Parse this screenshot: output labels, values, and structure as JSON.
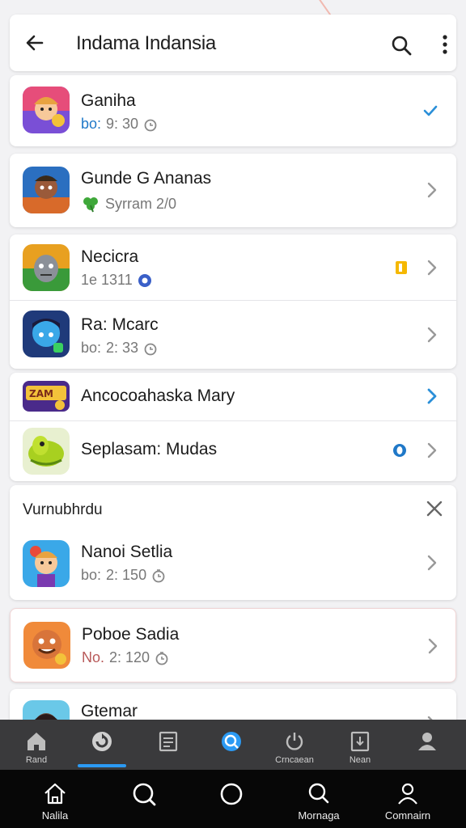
{
  "header": {
    "title": "Indama Indansia"
  },
  "apps": [
    {
      "name": "Ganiha",
      "meta_prefix": "bo:",
      "meta_value": "9: 30",
      "action": "check"
    },
    {
      "name": "Gunde G Ananas",
      "meta_prefix": "",
      "meta_value": "Syrram  2/0",
      "action": "chevron"
    },
    {
      "name": "Necicra",
      "meta_prefix": "",
      "meta_value": "1e 1311",
      "action": "chevron"
    },
    {
      "name": "Ra: Mcarc",
      "meta_prefix": "bo:",
      "meta_value": "2: 33",
      "action": "chevron"
    },
    {
      "name": "Ancocoahaska Mary",
      "action": "chevron-blue"
    },
    {
      "name": "Seplasam: Mudas",
      "action": "chevron"
    },
    {
      "name": "Nanoi Setlia",
      "meta_prefix": "bo:",
      "meta_value": "2: 150",
      "action": "chevron"
    },
    {
      "name": "Poboe Sadia",
      "meta_prefix": "No.",
      "meta_value": "2: 120",
      "action": "chevron"
    },
    {
      "name": "Gtemar",
      "action": "chevron"
    }
  ],
  "section": {
    "label": "Vurnubhrdu"
  },
  "tabbar": [
    {
      "label": "Rand",
      "icon": "home-icon"
    },
    {
      "label": "",
      "icon": "refresh-icon"
    },
    {
      "label": "",
      "icon": "document-icon"
    },
    {
      "label": "",
      "icon": "games-icon"
    },
    {
      "label": "Crncaean",
      "icon": "power-icon"
    },
    {
      "label": "Nean",
      "icon": "download-icon"
    },
    {
      "label": "",
      "icon": "person-icon"
    }
  ],
  "navbar": [
    {
      "label": "Nalila",
      "icon": "home-icon"
    },
    {
      "label": "",
      "icon": "search-icon"
    },
    {
      "label": "",
      "icon": "circle-icon"
    },
    {
      "label": "Mornaga",
      "icon": "search-icon"
    },
    {
      "label": "Comnairn",
      "icon": "person-icon"
    }
  ],
  "colors": {
    "accent": "#2b9af3",
    "check": "#2a8fd8",
    "badge_yellow": "#f5b800",
    "tabbar_bg": "#3a3a3c",
    "navbar_bg": "#070707"
  }
}
